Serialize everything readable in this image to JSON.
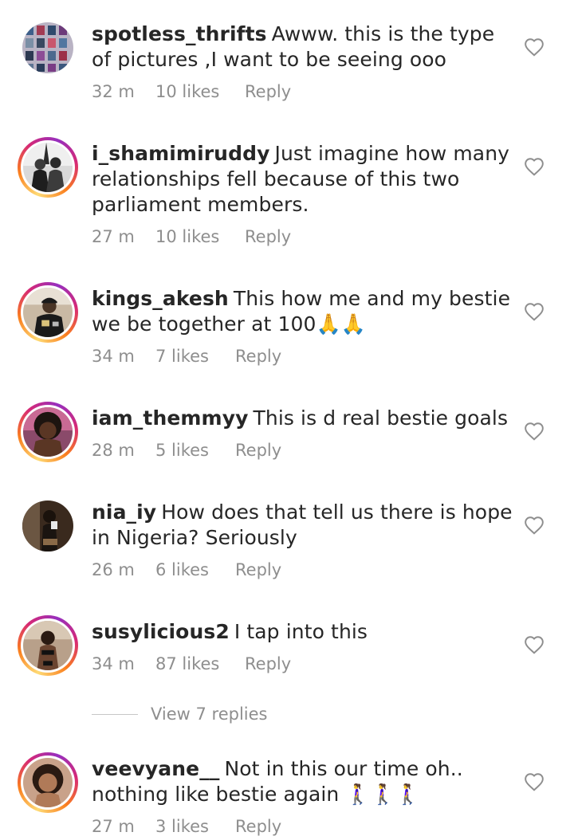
{
  "comments": [
    {
      "username": "spotless_thrifts",
      "text": "Awww. this is the type of pictures ,I want to be seeing ooo",
      "time": "32 m",
      "likes": "10 likes",
      "reply": "Reply",
      "avatar": "clothing-grid-avatar",
      "story_ring": false
    },
    {
      "username": "i_shamimiruddy",
      "text": "Just imagine how many relationships fell because of this two parliament members.",
      "time": "27 m",
      "likes": "10 likes",
      "reply": "Reply",
      "avatar": "couple-bw-avatar",
      "story_ring": true
    },
    {
      "username": "kings_akesh",
      "text": "This how me and my bestie we be together at 100🙏🙏",
      "time": "34 m",
      "likes": "7 likes",
      "reply": "Reply",
      "avatar": "man-cap-avatar",
      "story_ring": true
    },
    {
      "username": "iam_themmyy",
      "text": "This is d real bestie goals",
      "time": "28 m",
      "likes": "5 likes",
      "reply": "Reply",
      "avatar": "woman-portrait-avatar",
      "story_ring": true
    },
    {
      "username": "nia_iy",
      "text": "How does that tell us there is hope in Nigeria? Seriously",
      "time": "26 m",
      "likes": "6 likes",
      "reply": "Reply",
      "avatar": "woman-mirror-avatar",
      "story_ring": false
    },
    {
      "username": "susylicious2",
      "text": "I tap into this",
      "time": "34 m",
      "likes": "87 likes",
      "reply": "Reply",
      "avatar": "woman-dark-avatar",
      "story_ring": true
    },
    {
      "username": "veevyane__",
      "text": "Not in this our time oh.. nothing like bestie again 🚶‍♀️🚶‍♀️🚶‍♀️",
      "time": "27 m",
      "likes": "3 likes",
      "reply": "Reply",
      "avatar": "woman-closeup-avatar",
      "story_ring": true
    }
  ],
  "view_replies": "View 7 replies",
  "colors": {
    "text": "#262626",
    "meta": "#8e8e8e",
    "divider": "#c7c7c7",
    "story_ring_start": "#feda75",
    "story_ring_end": "#962fbf"
  }
}
